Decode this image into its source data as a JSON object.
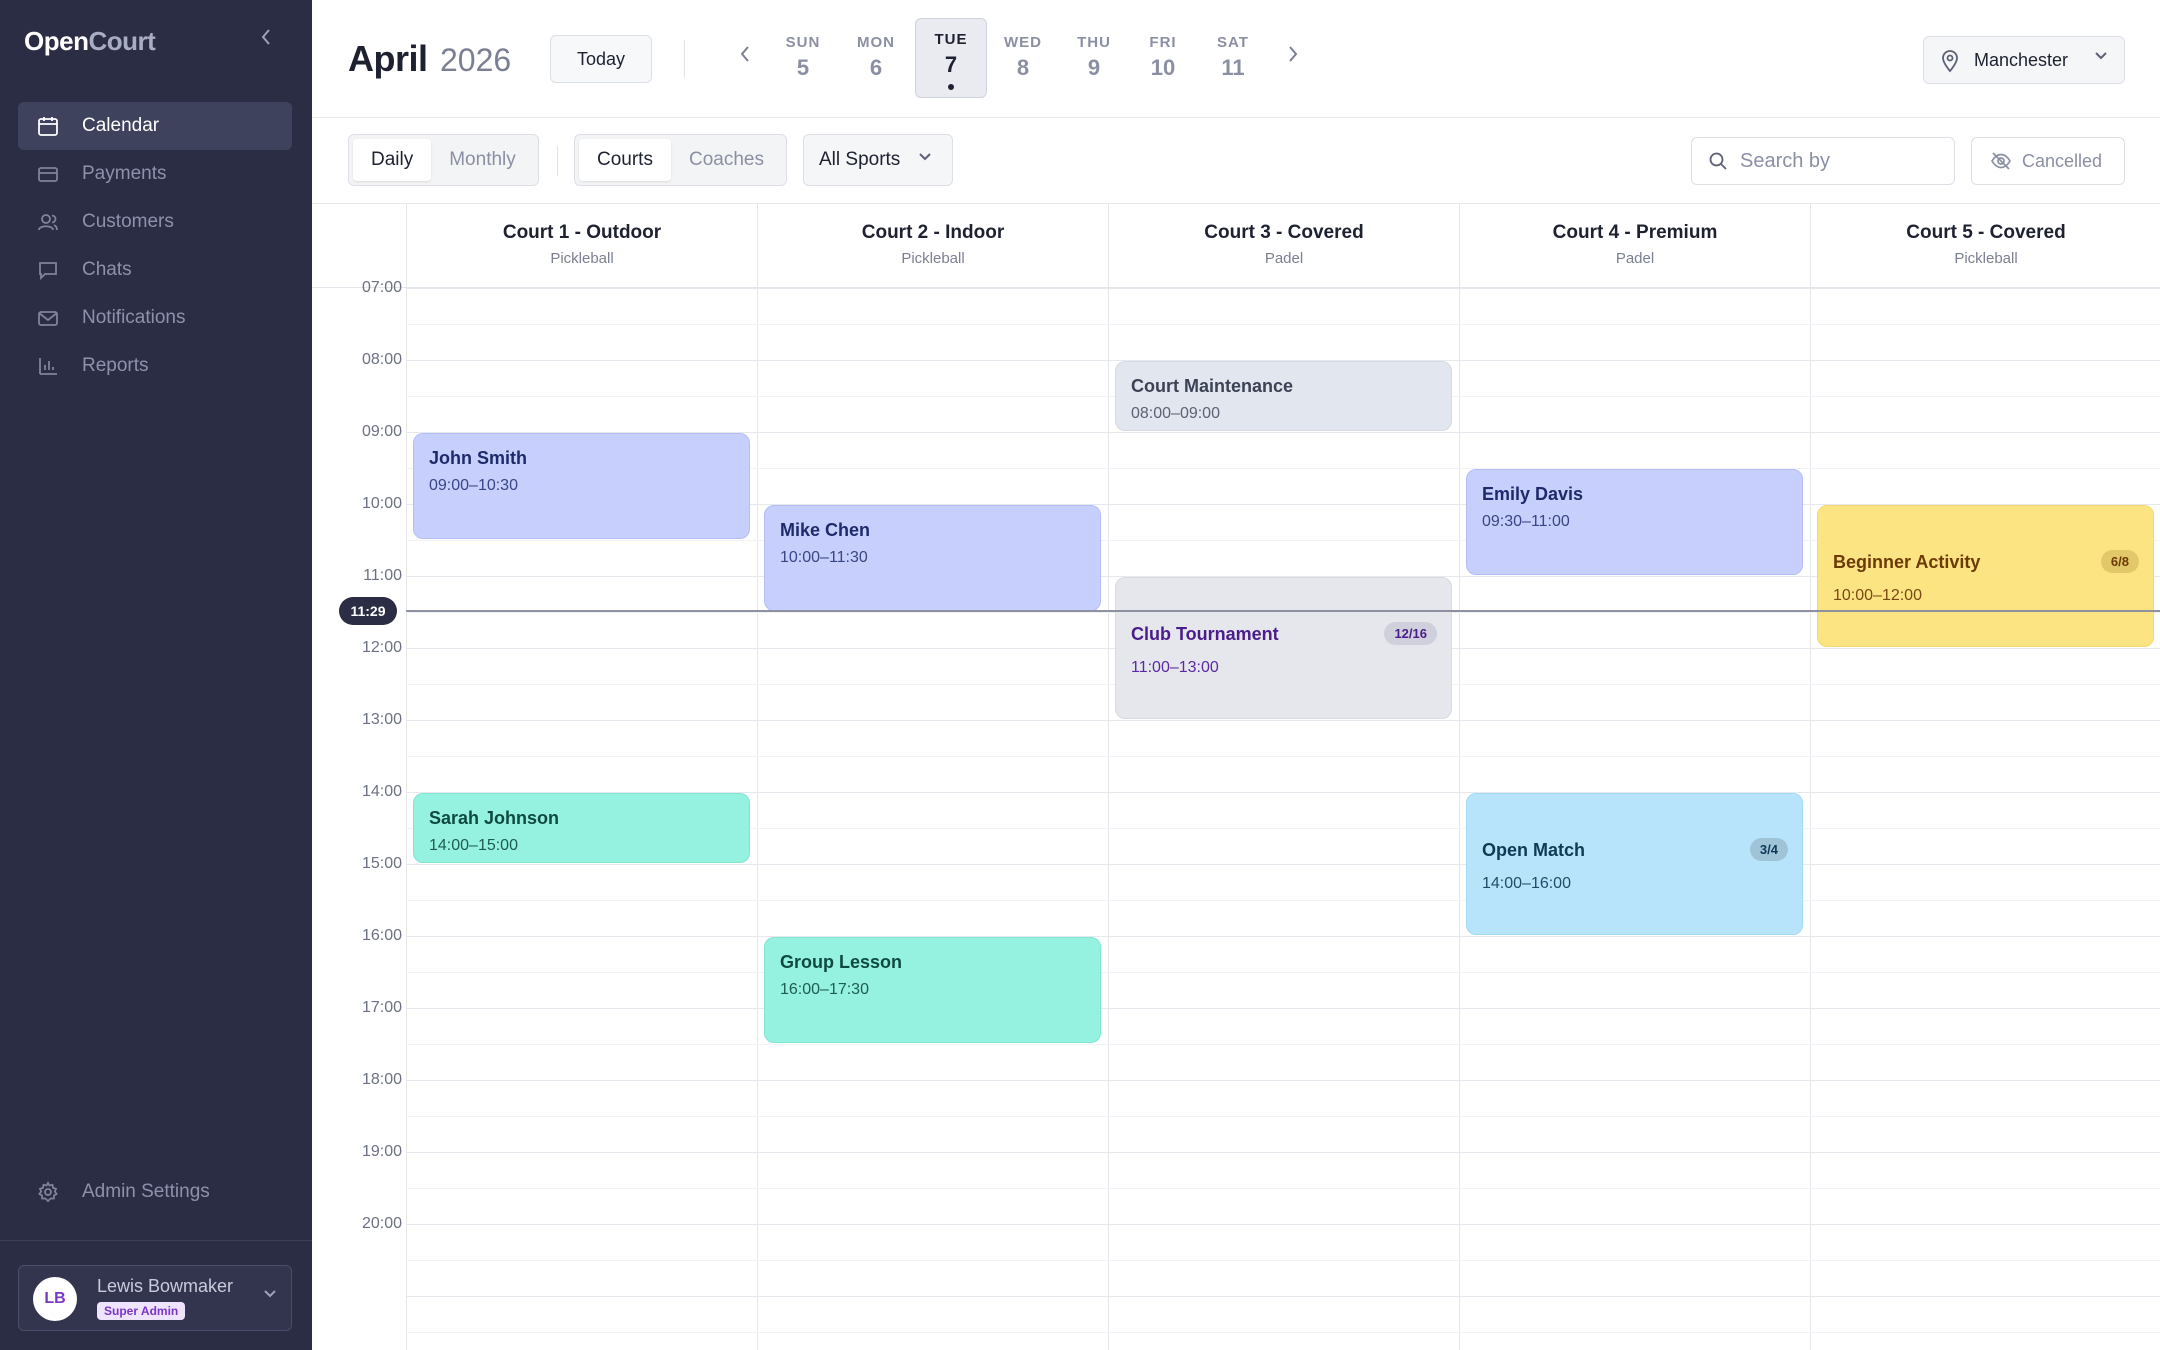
{
  "app": {
    "logo_part1": "Open",
    "logo_part2": "Court"
  },
  "sidebar": {
    "items": [
      {
        "label": "Calendar",
        "icon": "calendar-icon",
        "active": true
      },
      {
        "label": "Payments",
        "icon": "credit-card-icon",
        "active": false
      },
      {
        "label": "Customers",
        "icon": "users-icon",
        "active": false
      },
      {
        "label": "Chats",
        "icon": "chat-icon",
        "active": false
      },
      {
        "label": "Notifications",
        "icon": "mail-icon",
        "active": false
      },
      {
        "label": "Reports",
        "icon": "bar-chart-icon",
        "active": false
      }
    ],
    "admin_settings": "Admin Settings",
    "user": {
      "initials": "LB",
      "name": "Lewis Bowmaker",
      "role": "Super Admin"
    }
  },
  "header": {
    "month": "April",
    "year": "2026",
    "today_label": "Today",
    "days": [
      {
        "name": "SUN",
        "date": "5",
        "selected": false
      },
      {
        "name": "MON",
        "date": "6",
        "selected": false
      },
      {
        "name": "TUE",
        "date": "7",
        "selected": true
      },
      {
        "name": "WED",
        "date": "8",
        "selected": false
      },
      {
        "name": "THU",
        "date": "9",
        "selected": false
      },
      {
        "name": "FRI",
        "date": "10",
        "selected": false
      },
      {
        "name": "SAT",
        "date": "11",
        "selected": false
      }
    ],
    "location": "Manchester"
  },
  "toolbar": {
    "view_tabs": [
      {
        "label": "Daily",
        "selected": true
      },
      {
        "label": "Monthly",
        "selected": false
      }
    ],
    "resource_tabs": [
      {
        "label": "Courts",
        "selected": true
      },
      {
        "label": "Coaches",
        "selected": false
      }
    ],
    "sport_filter": "All Sports",
    "search_placeholder": "Search by",
    "cancelled_label": "Cancelled"
  },
  "calendar": {
    "courts": [
      {
        "name": "Court 1 - Outdoor",
        "sport": "Pickleball"
      },
      {
        "name": "Court 2 - Indoor",
        "sport": "Pickleball"
      },
      {
        "name": "Court 3 - Covered",
        "sport": "Padel"
      },
      {
        "name": "Court 4 - Premium",
        "sport": "Padel"
      },
      {
        "name": "Court 5 - Covered",
        "sport": "Pickleball"
      }
    ],
    "hours": [
      "07:00",
      "08:00",
      "09:00",
      "10:00",
      "11:00",
      "12:00",
      "13:00",
      "14:00",
      "15:00",
      "16:00",
      "17:00",
      "18:00",
      "19:00",
      "20:00"
    ],
    "current_time": "11:29",
    "events": [
      {
        "court": 0,
        "title": "John Smith",
        "time": "09:00–10:30",
        "start": 9,
        "end": 10.5,
        "style": "booking"
      },
      {
        "court": 0,
        "title": "Sarah Johnson",
        "time": "14:00–15:00",
        "start": 14,
        "end": 15,
        "style": "lesson"
      },
      {
        "court": 1,
        "title": "Mike Chen",
        "time": "10:00–11:30",
        "start": 10,
        "end": 11.5,
        "style": "booking"
      },
      {
        "court": 1,
        "title": "Group Lesson",
        "time": "16:00–17:30",
        "start": 16,
        "end": 17.5,
        "style": "lesson"
      },
      {
        "court": 2,
        "title": "Court Maintenance",
        "time": "08:00–09:00",
        "start": 8,
        "end": 9,
        "style": "maintenance"
      },
      {
        "court": 2,
        "title": "Club Tournament",
        "time": "11:00–13:00",
        "start": 11,
        "end": 13,
        "style": "tournament",
        "capacity": "12/16"
      },
      {
        "court": 3,
        "title": "Emily Davis",
        "time": "09:30–11:00",
        "start": 9.5,
        "end": 11,
        "style": "booking"
      },
      {
        "court": 3,
        "title": "Open Match",
        "time": "14:00–16:00",
        "start": 14,
        "end": 16,
        "style": "match",
        "capacity": "3/4"
      },
      {
        "court": 4,
        "title": "Beginner Activity",
        "time": "10:00–12:00",
        "start": 10,
        "end": 12,
        "style": "activity",
        "capacity": "6/8"
      }
    ],
    "event_colors": {
      "booking": {
        "bg": "#c7d0fc",
        "border": "#b3bef7",
        "title": "#1e2a6b",
        "time": "#3a4585"
      },
      "lesson": {
        "bg": "#95f2e0",
        "border": "#7fe6d2",
        "title": "#0f4a40",
        "time": "#1f5c50"
      },
      "maintenance": {
        "bg": "#e2e6ee",
        "border": "#d5dae4",
        "title": "#3d4255",
        "time": "#5d6175"
      },
      "tournament": {
        "bg": "#e5e7ec",
        "border": "#d8dbe2",
        "title": "#4b1c8c",
        "time": "#5b2aa0",
        "badge": "#cfd0db"
      },
      "match": {
        "bg": "#b8e4fb",
        "border": "#a2d9f6",
        "title": "#0f3a55",
        "time": "#1f4c68",
        "badge": "#9fc4d8"
      },
      "activity": {
        "bg": "#fde483",
        "border": "#f5d86e",
        "title": "#6b3a06",
        "time": "#7a4a14",
        "badge": "#e3c86a"
      }
    }
  }
}
